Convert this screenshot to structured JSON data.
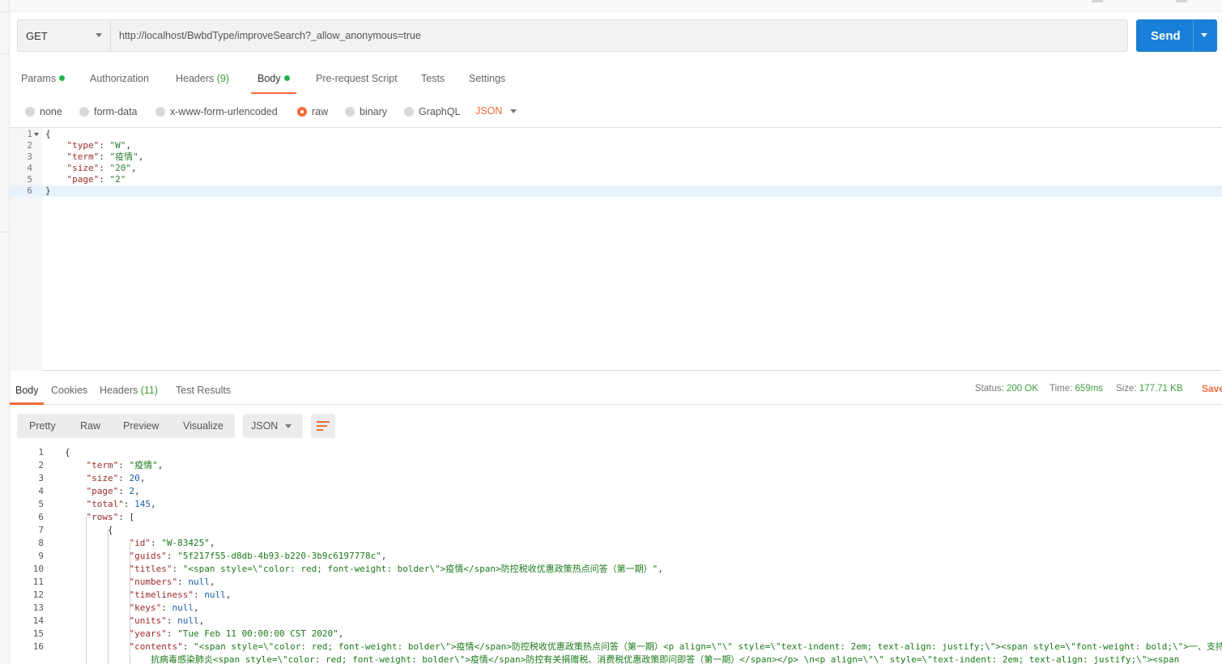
{
  "request": {
    "method": "GET",
    "url": "http://localhost/BwbdType/improveSearch?_allow_anonymous=true",
    "send_label": "Send"
  },
  "request_tabs": [
    {
      "label": "Params",
      "dot": true
    },
    {
      "label": "Authorization"
    },
    {
      "label": "Headers",
      "count": "(9)"
    },
    {
      "label": "Body",
      "dot": true,
      "active": true
    },
    {
      "label": "Pre-request Script"
    },
    {
      "label": "Tests"
    },
    {
      "label": "Settings"
    }
  ],
  "body_types": [
    "none",
    "form-data",
    "x-www-form-urlencoded",
    "raw",
    "binary",
    "GraphQL"
  ],
  "body_selected": "raw",
  "body_format": "JSON",
  "request_body": {
    "lines": [
      "1",
      "2",
      "3",
      "4",
      "5",
      "6"
    ],
    "open": "{",
    "close": "}",
    "k_type": "\"type\"",
    "v_type": "\"W\"",
    "k_term": "\"term\"",
    "v_term": "\"疫情\"",
    "k_size": "\"size\"",
    "v_size": "\"20\"",
    "k_page": "\"page\"",
    "v_page": "\"2\""
  },
  "response_tabs": [
    {
      "label": "Body",
      "active": true
    },
    {
      "label": "Cookies"
    },
    {
      "label": "Headers",
      "count": "(11)"
    },
    {
      "label": "Test Results"
    }
  ],
  "response_meta": {
    "status_label": "Status:",
    "status": "200 OK",
    "time_label": "Time:",
    "time": "659ms",
    "size_label": "Size:",
    "size": "177.71 KB",
    "save": "Save"
  },
  "view_modes": [
    "Pretty",
    "Raw",
    "Preview",
    "Visualize"
  ],
  "response_format": "JSON",
  "response_body": {
    "l1": "{",
    "k_term": "\"term\"",
    "v_term": "\"疫情\"",
    "k_size": "\"size\"",
    "v_size": "20",
    "k_page": "\"page\"",
    "v_page": "2",
    "k_total": "\"total\"",
    "v_total": "145",
    "k_rows": "\"rows\"",
    "v_rows": "[",
    "l7": "{",
    "k_id": "\"id\"",
    "v_id": "\"W-83425\"",
    "k_guids": "\"guids\"",
    "v_guids": "\"5f217f55-d8db-4b93-b220-3b9c6197778c\"",
    "k_titles": "\"titles\"",
    "v_titles": "\"<span style=\\\"color: red; font-weight: bolder\\\">疫情</span>防控税收优惠政策热点问答（第一期）\"",
    "k_numbers": "\"numbers\"",
    "v_numbers": "null",
    "k_timeliness": "\"timeliness\"",
    "v_timeliness": "null",
    "k_keys": "\"keys\"",
    "v_keys": "null",
    "k_units": "\"units\"",
    "v_units": "null",
    "k_years": "\"years\"",
    "v_years": "\"Tue Feb 11 00:00:00 CST 2020\"",
    "k_contents": "\"contents\"",
    "v_contents": "\"<span style=\\\"color: red; font-weight: bolder\\\">疫情</span>防控税收优惠政策热点问答（第一期）<p align=\\\"\\\" style=\\\"text-indent: 2em; text-align: justify;\\\"><span style=\\\"font-weight: bold;\\\">一、支持",
    "v_contents_wrap": "抗病毒感染肺炎<span style=\\\"color: red; font-weight: bolder\\\">疫情</span>防控有关捐赠税、消费税优惠政策即问即答（第一期）</span></p> \\n<p align=\\\"\\\" style=\\\"text-indent: 2em; text-align: justify;\\\"><span"
  },
  "colors": {
    "accent": "#f26b3a",
    "send": "#1a7fd8",
    "ok": "#3c9e3c"
  }
}
